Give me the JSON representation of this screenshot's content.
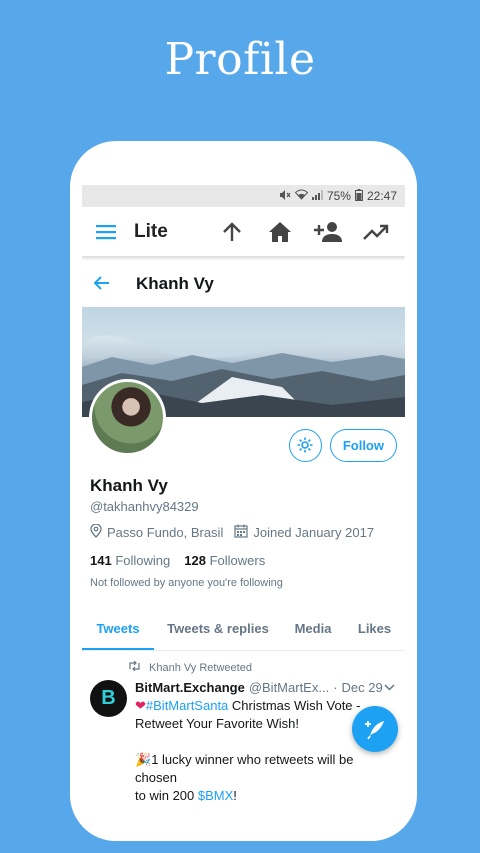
{
  "promo": {
    "title": "Profile"
  },
  "status_bar": {
    "battery": "75%",
    "time": "22:47"
  },
  "toolbar": {
    "brand": "Lite"
  },
  "profile": {
    "header_name": "Khanh Vy",
    "display_name": "Khanh Vy",
    "handle": "@takhanhvy84329",
    "location": "Passo Fundo, Brasil",
    "joined": "Joined January 2017",
    "following_count": "141",
    "following_label": "Following",
    "followers_count": "128",
    "followers_label": "Followers",
    "note": "Not followed by anyone you're following",
    "follow_label": "Follow"
  },
  "tabs": [
    "Tweets",
    "Tweets & replies",
    "Media",
    "Likes"
  ],
  "tweet": {
    "retweet_label": "Khanh Vy Retweeted",
    "user_name": "BitMart.Exchange",
    "user_handle": "@BitMartEx...",
    "dot": "·",
    "date": "Dec 29",
    "avatar_letter": "B",
    "line1_hashtag": "#BitMartSanta",
    "line1_text": " Christmas Wish Vote - Retweet Your Favorite Wish!",
    "line2_text": "1 lucky winner who retweets will be",
    "line2_hidden": "chosen",
    "line3_text": "to win 200 ",
    "line3_link": "$BMX",
    "line3_end": "!"
  },
  "colors": {
    "accent": "#1da1f2",
    "background": "#57a8ea"
  }
}
